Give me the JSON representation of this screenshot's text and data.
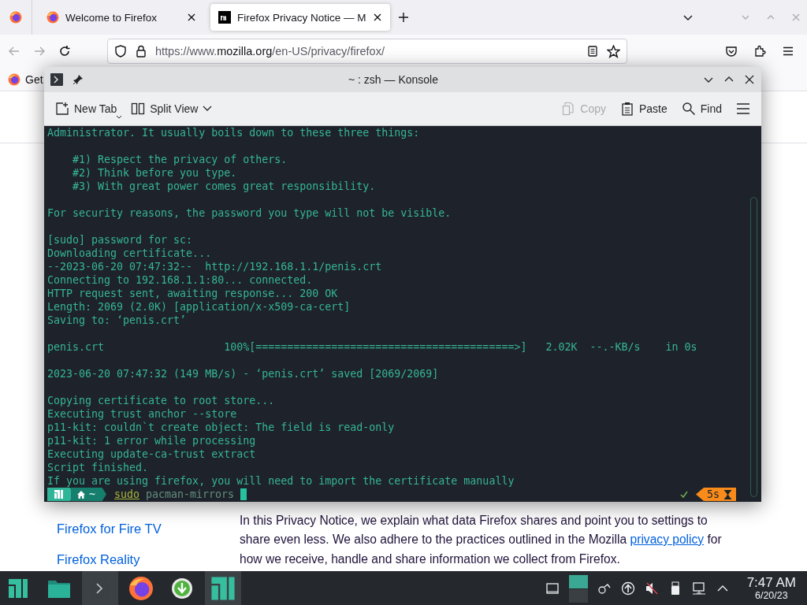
{
  "browser": {
    "tabs": [
      {
        "kind": "pinned",
        "selected": false
      },
      {
        "kind": "tab",
        "title": "Welcome to Firefox",
        "selected": false
      },
      {
        "kind": "tab",
        "title": "Firefox Privacy Notice — M",
        "selected": true
      }
    ],
    "url_parts": [
      "https://www.",
      "mozilla.org",
      "/en-US/privacy/firefox/"
    ],
    "bookmarks": [
      {
        "label": "Get"
      }
    ],
    "page": {
      "sidebar_links": [
        "Firefox for Fire TV",
        "Firefox Reality"
      ],
      "paragraph": {
        "before": "In this Privacy Notice, we explain what data Firefox shares and point you to settings to share even less. We also adhere to the practices outlined in the Mozilla ",
        "link": "privacy policy",
        "after": " for how we receive, handle and share information we collect from Firefox."
      }
    }
  },
  "konsole": {
    "title": "~ : zsh — Konsole",
    "toolbar": [
      {
        "kind": "new-tab",
        "label": "New Tab",
        "disabled": false
      },
      {
        "kind": "split",
        "label": "Split View",
        "disabled": false
      },
      {
        "kind": "copy",
        "label": "Copy",
        "disabled": true
      },
      {
        "kind": "paste",
        "label": "Paste",
        "disabled": false
      },
      {
        "kind": "find",
        "label": "Find",
        "disabled": false
      }
    ],
    "blocks": [
      [
        "Administrator. It usually boils down to these three things:"
      ],
      [
        "    #1) Respect the privacy of others.",
        "    #2) Think before you type.",
        "    #3) With great power comes great responsibility."
      ],
      [
        "For security reasons, the password you type will not be visible."
      ],
      [
        "[sudo] password for sc:",
        "Downloading certificate...",
        "--2023-06-20 07:47:32--  http://192.168.1.1/penis.crt",
        "Connecting to 192.168.1.1:80... connected.",
        "HTTP request sent, awaiting response... 200 OK",
        "Length: 2069 (2.0K) [application/x-x509-ca-cert]",
        "Saving to: ‘penis.crt’"
      ],
      [
        "penis.crt                   100%[=========================================>]   2.02K  --.-KB/s    in 0s"
      ],
      [
        "2023-06-20 07:47:32 (149 MB/s) - ‘penis.crt’ saved [2069/2069]"
      ],
      [
        "Copying certificate to root store...",
        "Executing trust anchor --store",
        "p11-kit: couldn`t create object: The field is read-only",
        "p11-kit: 1 error while processing",
        "Executing update-ca-trust extract",
        "Script finished.",
        "If you are using firefox, you will need to import the certificate manually"
      ]
    ],
    "prompt": {
      "path": "~",
      "command": "sudo",
      "args": "pacman-mirrors",
      "elapsed": "5s"
    }
  },
  "taskbar": {
    "apps": [
      {
        "kind": "launcher",
        "active": false
      },
      {
        "kind": "files",
        "active": false
      },
      {
        "kind": "terminal",
        "active": true
      },
      {
        "kind": "browser",
        "active": false
      },
      {
        "kind": "download",
        "active": false
      },
      {
        "kind": "welcome",
        "active": true
      }
    ],
    "clock": {
      "time": "7:47 AM",
      "date": "6/20/23"
    }
  }
}
